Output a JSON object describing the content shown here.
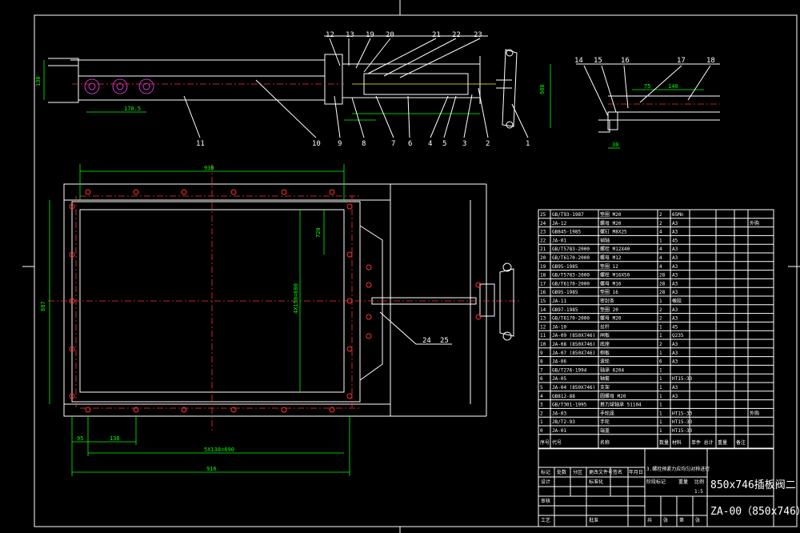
{
  "callouts_top": [
    "12",
    "13",
    "19",
    "20",
    "21",
    "22",
    "23"
  ],
  "callouts_bottom": [
    "11",
    "10",
    "9",
    "8",
    "7",
    "6",
    "4",
    "5",
    "3",
    "2",
    "1"
  ],
  "callouts_right": [
    "14",
    "15",
    "16",
    "17",
    "18"
  ],
  "callouts_plan": [
    "24",
    "25"
  ],
  "dims": {
    "side_height": "130",
    "side_pitch": "170.5",
    "side_len": "980",
    "plan_top": "930",
    "plan_inner": "720",
    "plan_height": "887",
    "plan_opening": "4X150=600",
    "plan_bottom_a": "95",
    "plan_bottom_b": "138",
    "plan_bottom_c": "5X138=690",
    "plan_bottom_total": "916",
    "detail_a": "75",
    "detail_b": "140",
    "detail_c": "30"
  },
  "bom_rows": [
    {
      "no": "25",
      "code": "GB/T93-1987",
      "name": "垫圈 M20",
      "qty": "2",
      "mat": "65Mn",
      "note": ""
    },
    {
      "no": "24",
      "code": "JA-12",
      "name": "螺母 M20",
      "qty": "2",
      "mat": "A3",
      "note": "外购"
    },
    {
      "no": "23",
      "code": "GB845-1985",
      "name": "螺钉 M8X25",
      "qty": "4",
      "mat": "A3",
      "note": ""
    },
    {
      "no": "22",
      "code": "JA-01",
      "name": "销轴",
      "qty": "1",
      "mat": "45",
      "note": ""
    },
    {
      "no": "21",
      "code": "GB/T5783-2000",
      "name": "螺栓 M12X40",
      "qty": "4",
      "mat": "A3",
      "note": ""
    },
    {
      "no": "20",
      "code": "GB/T6170-2000",
      "name": "螺母 M12",
      "qty": "4",
      "mat": "A3",
      "note": ""
    },
    {
      "no": "19",
      "code": "GB95-1985",
      "name": "垫圈 12",
      "qty": "4",
      "mat": "A3",
      "note": ""
    },
    {
      "no": "18",
      "code": "GB/T5783-2000",
      "name": "螺栓 M16X50",
      "qty": "28",
      "mat": "A3",
      "note": ""
    },
    {
      "no": "17",
      "code": "GB/T6170-2000",
      "name": "螺母 M16",
      "qty": "28",
      "mat": "A3",
      "note": ""
    },
    {
      "no": "16",
      "code": "GB95-1985",
      "name": "垫圈 16",
      "qty": "28",
      "mat": "A3",
      "note": ""
    },
    {
      "no": "15",
      "code": "JA-11",
      "name": "密封条",
      "qty": "1",
      "mat": "橡胶",
      "note": ""
    },
    {
      "no": "14",
      "code": "GB97-1985",
      "name": "垫圈 20",
      "qty": "2",
      "mat": "A3",
      "note": ""
    },
    {
      "no": "13",
      "code": "GB/T6170-2000",
      "name": "螺母 M20",
      "qty": "2",
      "mat": "A3",
      "note": ""
    },
    {
      "no": "12",
      "code": "JA-10",
      "name": "丝杆",
      "qty": "1",
      "mat": "45",
      "note": ""
    },
    {
      "no": "11",
      "code": "JA-09 (850X746)",
      "name": "闸板",
      "qty": "1",
      "mat": "Q235",
      "note": ""
    },
    {
      "no": "10",
      "code": "JA-08 (850X746)",
      "name": "底座",
      "qty": "2",
      "mat": "A3",
      "note": ""
    },
    {
      "no": "9",
      "code": "JA-07 (850X746)",
      "name": "侧板",
      "qty": "1",
      "mat": "A3",
      "note": ""
    },
    {
      "no": "8",
      "code": "JA-06",
      "name": "滚轮",
      "qty": "6",
      "mat": "A3",
      "note": ""
    },
    {
      "no": "7",
      "code": "GB/T276-1994",
      "name": "轴承 6204",
      "qty": "1",
      "mat": "",
      "note": ""
    },
    {
      "no": "6",
      "code": "JA-05",
      "name": "轴套",
      "qty": "1",
      "mat": "HT15-33",
      "note": ""
    },
    {
      "no": "5",
      "code": "JA-04 (850X746)",
      "name": "支架",
      "qty": "1",
      "mat": "A3",
      "note": ""
    },
    {
      "no": "4",
      "code": "GB812-88",
      "name": "圆螺母 M20",
      "qty": "1",
      "mat": "A3",
      "note": ""
    },
    {
      "no": "3",
      "code": "GB/T301-1995",
      "name": "推力球轴承 51104",
      "qty": "1",
      "mat": "",
      "note": ""
    },
    {
      "no": "2",
      "code": "JA-03",
      "name": "手轮座",
      "qty": "1",
      "mat": "HT15-33",
      "note": "外购"
    },
    {
      "no": "1",
      "code": "JB/T2-93",
      "name": "手轮",
      "qty": "1",
      "mat": "HT15-33",
      "note": ""
    },
    {
      "no": "0",
      "code": "JA-01",
      "name": "端盖",
      "qty": "1",
      "mat": "HT15-33",
      "note": ""
    }
  ],
  "bom_header": [
    "序号",
    "代号",
    "名称",
    "数量",
    "材料",
    "单件 总计",
    "重量",
    "备注"
  ],
  "title_block": {
    "tech_note": "3.螺栓预紧力应均匀对称进行",
    "product_name": "850x746插板阀二",
    "drawing_no": "ZA-00（850x746）",
    "labels": [
      "标记",
      "处数",
      "分区",
      "更改文件号",
      "签名",
      "年月日",
      "设计",
      "标准化",
      "阶段标记",
      "重量",
      "比例",
      "审核",
      "工艺",
      "批准",
      "共",
      "张",
      "第",
      "张"
    ],
    "scale": "1:5"
  }
}
